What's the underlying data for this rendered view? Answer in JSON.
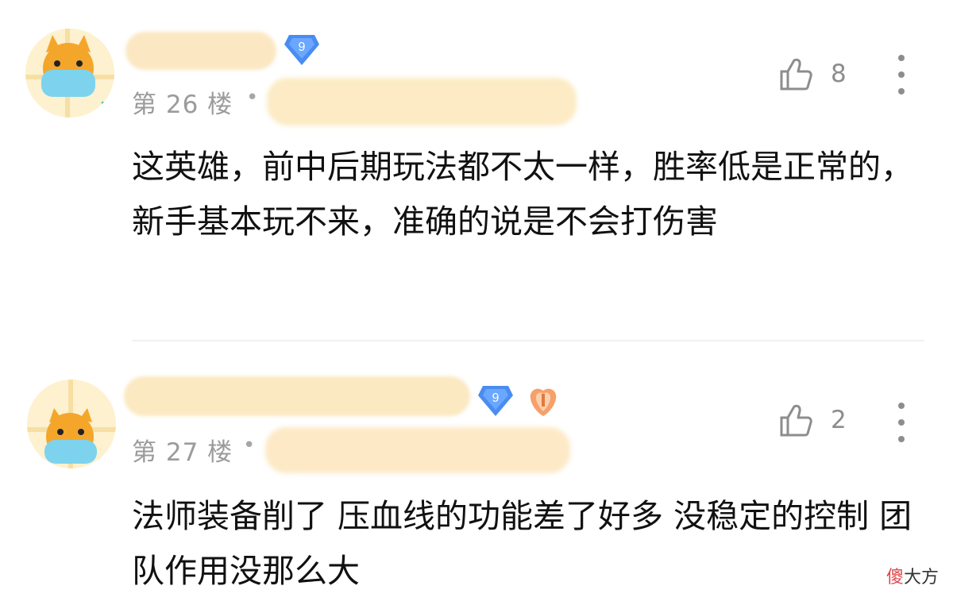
{
  "comments": [
    {
      "floor": "第 26 楼",
      "separator": "•",
      "level": "9",
      "likes": "8",
      "text": "这英雄，前中后期玩法都不太一样，胜率低是正常的，新手基本玩不来，准确的说是不会打伤害"
    },
    {
      "floor": "第 27 楼",
      "separator": "•",
      "level": "9",
      "likes": "2",
      "text": "法师装备削了 压血线的功能差了好多 没稳定的控制 团队作用没那么大"
    }
  ],
  "watermark": {
    "part1": "傻",
    "part2": "大方"
  },
  "colors": {
    "accent_badge": "#4a8cf0",
    "muted": "#9b9b9b",
    "text": "#111111"
  },
  "icons": [
    "avatar",
    "level-badge-icon",
    "gift-icon",
    "thumbs-up-icon",
    "more-icon"
  ]
}
